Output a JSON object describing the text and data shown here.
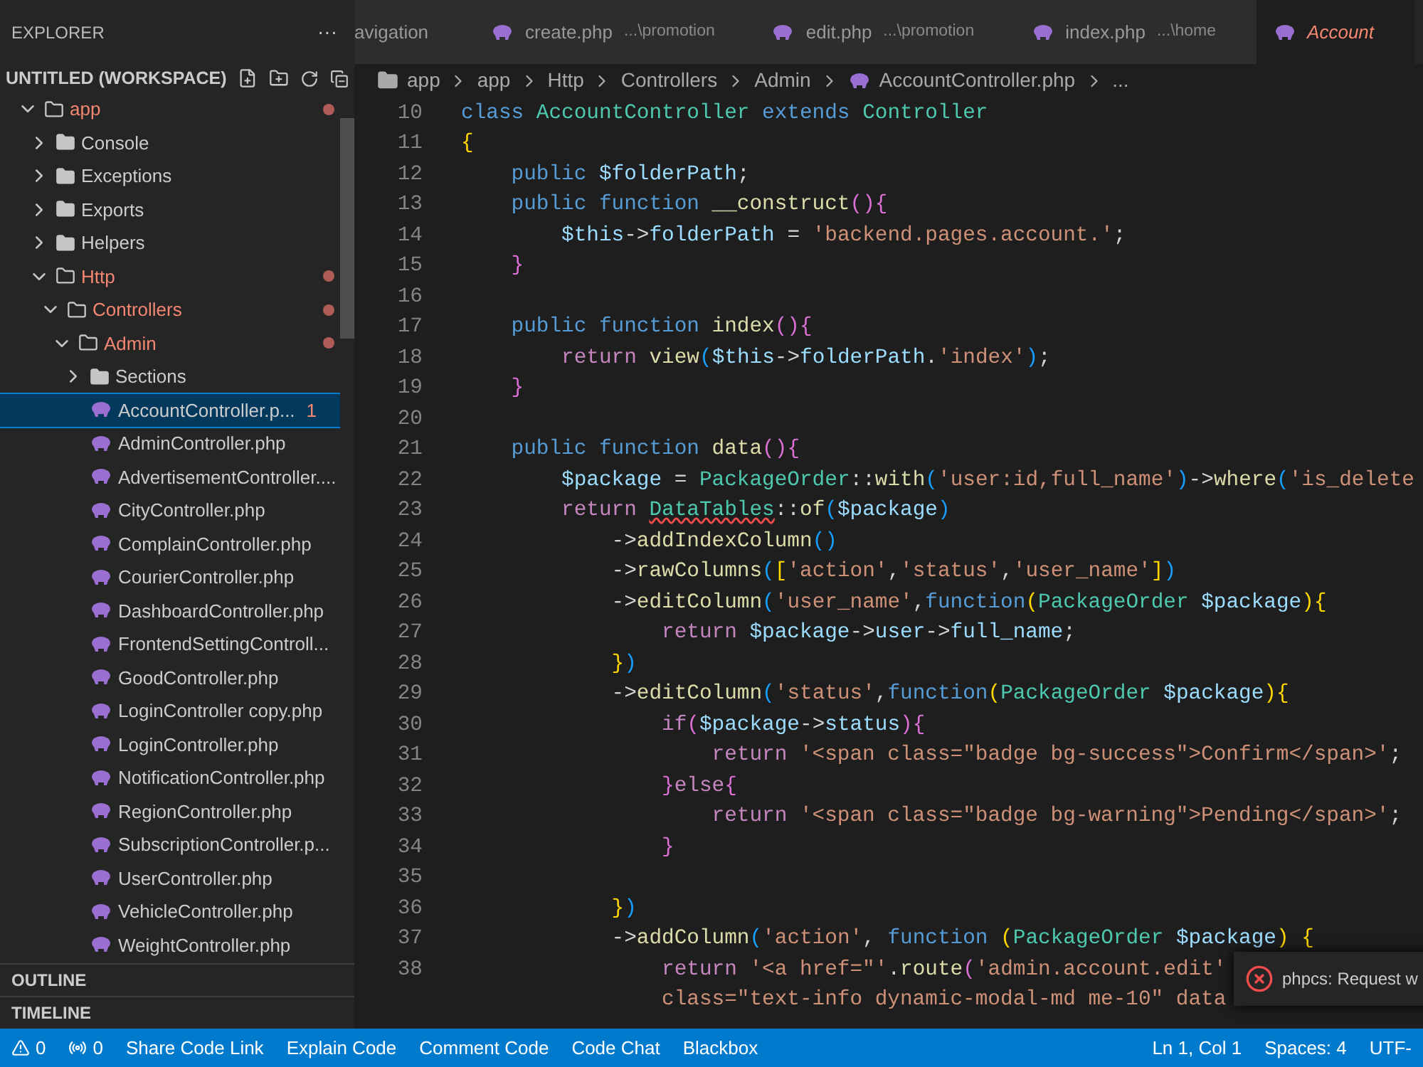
{
  "sidebar": {
    "title": "EXPLORER",
    "more": "···",
    "workspace": "UNTITLED (WORKSPACE)",
    "tree": [
      {
        "kind": "folder",
        "name": "app",
        "expanded": true,
        "modified": true,
        "selected": false,
        "children": [
          {
            "kind": "folder",
            "name": "Console",
            "expanded": false,
            "modified": false,
            "selected": false
          },
          {
            "kind": "folder",
            "name": "Exceptions",
            "expanded": false,
            "modified": false,
            "selected": false
          },
          {
            "kind": "folder",
            "name": "Exports",
            "expanded": false,
            "modified": false,
            "selected": false
          },
          {
            "kind": "folder",
            "name": "Helpers",
            "expanded": false,
            "modified": false,
            "selected": false
          },
          {
            "kind": "folder",
            "name": "Http",
            "expanded": true,
            "modified": true,
            "selected": false,
            "children": [
              {
                "kind": "folder",
                "name": "Controllers",
                "expanded": true,
                "modified": true,
                "selected": false,
                "children": [
                  {
                    "kind": "folder",
                    "name": "Admin",
                    "expanded": true,
                    "modified": true,
                    "selected": false,
                    "children": [
                      {
                        "kind": "folder",
                        "name": "Sections",
                        "expanded": false,
                        "modified": false,
                        "selected": false
                      },
                      {
                        "kind": "file",
                        "name": "AccountController.p...",
                        "badge": "1",
                        "selected": true
                      },
                      {
                        "kind": "file",
                        "name": "AdminController.php",
                        "selected": false
                      },
                      {
                        "kind": "file",
                        "name": "AdvertisementController....",
                        "selected": false
                      },
                      {
                        "kind": "file",
                        "name": "CityController.php",
                        "selected": false
                      },
                      {
                        "kind": "file",
                        "name": "ComplainController.php",
                        "selected": false
                      },
                      {
                        "kind": "file",
                        "name": "CourierController.php",
                        "selected": false
                      },
                      {
                        "kind": "file",
                        "name": "DashboardController.php",
                        "selected": false
                      },
                      {
                        "kind": "file",
                        "name": "FrontendSettingControll...",
                        "selected": false
                      },
                      {
                        "kind": "file",
                        "name": "GoodController.php",
                        "selected": false
                      },
                      {
                        "kind": "file",
                        "name": "LoginController copy.php",
                        "selected": false
                      },
                      {
                        "kind": "file",
                        "name": "LoginController.php",
                        "selected": false
                      },
                      {
                        "kind": "file",
                        "name": "NotificationController.php",
                        "selected": false
                      },
                      {
                        "kind": "file",
                        "name": "RegionController.php",
                        "selected": false
                      },
                      {
                        "kind": "file",
                        "name": "SubscriptionController.p...",
                        "selected": false
                      },
                      {
                        "kind": "file",
                        "name": "UserController.php",
                        "selected": false
                      },
                      {
                        "kind": "file",
                        "name": "VehicleController.php",
                        "selected": false
                      },
                      {
                        "kind": "file",
                        "name": "WeightController.php",
                        "selected": false
                      }
                    ]
                  }
                ]
              }
            ]
          }
        ]
      }
    ],
    "panels": [
      "OUTLINE",
      "TIMELINE"
    ]
  },
  "tabs": [
    {
      "kind": "plain",
      "name": "avigation",
      "selected": false,
      "has_error": false
    },
    {
      "kind": "php",
      "name": "create.php",
      "path": "...\\promotion",
      "selected": false,
      "has_error": false
    },
    {
      "kind": "php",
      "name": "edit.php",
      "path": "...\\promotion",
      "selected": false,
      "has_error": false
    },
    {
      "kind": "php",
      "name": "index.php",
      "path": "...\\home",
      "selected": false,
      "has_error": false
    },
    {
      "kind": "php",
      "name": "Account",
      "selected": true,
      "has_error": true
    }
  ],
  "breadcrumbs": [
    {
      "kind": "folder",
      "label": "app"
    },
    {
      "kind": "plain",
      "label": "app"
    },
    {
      "kind": "plain",
      "label": "Http"
    },
    {
      "kind": "plain",
      "label": "Controllers"
    },
    {
      "kind": "plain",
      "label": "Admin"
    },
    {
      "kind": "file",
      "label": "AccountController.php"
    },
    {
      "kind": "plain",
      "label": "..."
    }
  ],
  "code": [
    {
      "number": "10",
      "tokens": [
        {
          "text": "class ",
          "kind": "kw"
        },
        {
          "text": "AccountController ",
          "kind": "cls"
        },
        {
          "text": "extends ",
          "kind": "kw"
        },
        {
          "text": "Controller",
          "kind": "cls"
        }
      ]
    },
    {
      "number": "11",
      "tokens": [
        {
          "text": "{",
          "kind": "b1"
        }
      ]
    },
    {
      "number": "12",
      "tokens": [
        {
          "text": "    public ",
          "kind": "kw"
        },
        {
          "text": "$folderPath",
          "kind": "var"
        },
        {
          "text": ";",
          "kind": "p"
        }
      ]
    },
    {
      "number": "13",
      "tokens": [
        {
          "text": "    public function ",
          "kind": "kw"
        },
        {
          "text": "__construct",
          "kind": "fn"
        },
        {
          "text": "()",
          "kind": "b2"
        },
        {
          "text": "{",
          "kind": "b2"
        }
      ]
    },
    {
      "number": "14",
      "tokens": [
        {
          "text": "        $this",
          "kind": "var"
        },
        {
          "text": "->",
          "kind": "p"
        },
        {
          "text": "folderPath",
          "kind": "var"
        },
        {
          "text": " = ",
          "kind": "p"
        },
        {
          "text": "'backend.pages.account.'",
          "kind": "str"
        },
        {
          "text": ";",
          "kind": "p"
        }
      ]
    },
    {
      "number": "15",
      "tokens": [
        {
          "text": "    }",
          "kind": "b2"
        }
      ]
    },
    {
      "number": "16"
    },
    {
      "number": "17",
      "tokens": [
        {
          "text": "    public function ",
          "kind": "kw"
        },
        {
          "text": "index",
          "kind": "fn"
        },
        {
          "text": "()",
          "kind": "b2"
        },
        {
          "text": "{",
          "kind": "b2"
        }
      ]
    },
    {
      "number": "18",
      "tokens": [
        {
          "text": "        return ",
          "kind": "ctl"
        },
        {
          "text": "view",
          "kind": "fn"
        },
        {
          "text": "(",
          "kind": "b3"
        },
        {
          "text": "$this",
          "kind": "var"
        },
        {
          "text": "->",
          "kind": "p"
        },
        {
          "text": "folderPath",
          "kind": "var"
        },
        {
          "text": ".",
          "kind": "p"
        },
        {
          "text": "'index'",
          "kind": "str"
        },
        {
          "text": ")",
          "kind": "b3"
        },
        {
          "text": ";",
          "kind": "p"
        }
      ]
    },
    {
      "number": "19",
      "tokens": [
        {
          "text": "    }",
          "kind": "b2"
        }
      ]
    },
    {
      "number": "20"
    },
    {
      "number": "21",
      "tokens": [
        {
          "text": "    public function ",
          "kind": "kw"
        },
        {
          "text": "data",
          "kind": "fn"
        },
        {
          "text": "()",
          "kind": "b2"
        },
        {
          "text": "{",
          "kind": "b2"
        }
      ]
    },
    {
      "number": "22",
      "tokens": [
        {
          "text": "        $package",
          "kind": "var"
        },
        {
          "text": " = ",
          "kind": "p"
        },
        {
          "text": "PackageOrder",
          "kind": "cls"
        },
        {
          "text": "::",
          "kind": "p"
        },
        {
          "text": "with",
          "kind": "fn"
        },
        {
          "text": "(",
          "kind": "b3"
        },
        {
          "text": "'user:id,full_name'",
          "kind": "str"
        },
        {
          "text": ")",
          "kind": "b3"
        },
        {
          "text": "->",
          "kind": "p"
        },
        {
          "text": "where",
          "kind": "fn"
        },
        {
          "text": "(",
          "kind": "b3"
        },
        {
          "text": "'is_delete",
          "kind": "str"
        }
      ]
    },
    {
      "number": "23",
      "tokens": [
        {
          "text": "        return ",
          "kind": "ctl"
        },
        {
          "text": "DataTables",
          "kind": "err"
        },
        {
          "text": "::",
          "kind": "p"
        },
        {
          "text": "of",
          "kind": "fn"
        },
        {
          "text": "(",
          "kind": "b3"
        },
        {
          "text": "$package",
          "kind": "var"
        },
        {
          "text": ")",
          "kind": "b3"
        }
      ]
    },
    {
      "number": "24",
      "tokens": [
        {
          "text": "            ->",
          "kind": "p"
        },
        {
          "text": "addIndexColumn",
          "kind": "fn"
        },
        {
          "text": "()",
          "kind": "b3"
        }
      ]
    },
    {
      "number": "25",
      "tokens": [
        {
          "text": "            ->",
          "kind": "p"
        },
        {
          "text": "rawColumns",
          "kind": "fn"
        },
        {
          "text": "(",
          "kind": "b3"
        },
        {
          "text": "[",
          "kind": "b1"
        },
        {
          "text": "'action'",
          "kind": "str"
        },
        {
          "text": ",",
          "kind": "p"
        },
        {
          "text": "'status'",
          "kind": "str"
        },
        {
          "text": ",",
          "kind": "p"
        },
        {
          "text": "'user_name'",
          "kind": "str"
        },
        {
          "text": "]",
          "kind": "b1"
        },
        {
          "text": ")",
          "kind": "b3"
        }
      ]
    },
    {
      "number": "26",
      "tokens": [
        {
          "text": "            ->",
          "kind": "p"
        },
        {
          "text": "editColumn",
          "kind": "fn"
        },
        {
          "text": "(",
          "kind": "b3"
        },
        {
          "text": "'user_name'",
          "kind": "str"
        },
        {
          "text": ",",
          "kind": "p"
        },
        {
          "text": "function",
          "kind": "kw"
        },
        {
          "text": "(",
          "kind": "b1"
        },
        {
          "text": "PackageOrder ",
          "kind": "cls"
        },
        {
          "text": "$package",
          "kind": "var"
        },
        {
          "text": ")",
          "kind": "b1"
        },
        {
          "text": "{",
          "kind": "b1"
        }
      ]
    },
    {
      "number": "27",
      "tokens": [
        {
          "text": "                return ",
          "kind": "ctl"
        },
        {
          "text": "$package",
          "kind": "var"
        },
        {
          "text": "->",
          "kind": "p"
        },
        {
          "text": "user",
          "kind": "var"
        },
        {
          "text": "->",
          "kind": "p"
        },
        {
          "text": "full_name",
          "kind": "var"
        },
        {
          "text": ";",
          "kind": "p"
        }
      ]
    },
    {
      "number": "28",
      "tokens": [
        {
          "text": "            }",
          "kind": "b1"
        },
        {
          "text": ")",
          "kind": "b3"
        }
      ]
    },
    {
      "number": "29",
      "tokens": [
        {
          "text": "            ->",
          "kind": "p"
        },
        {
          "text": "editColumn",
          "kind": "fn"
        },
        {
          "text": "(",
          "kind": "b3"
        },
        {
          "text": "'status'",
          "kind": "str"
        },
        {
          "text": ",",
          "kind": "p"
        },
        {
          "text": "function",
          "kind": "kw"
        },
        {
          "text": "(",
          "kind": "b1"
        },
        {
          "text": "PackageOrder ",
          "kind": "cls"
        },
        {
          "text": "$package",
          "kind": "var"
        },
        {
          "text": ")",
          "kind": "b1"
        },
        {
          "text": "{",
          "kind": "b1"
        }
      ]
    },
    {
      "number": "30",
      "tokens": [
        {
          "text": "                if",
          "kind": "ctl"
        },
        {
          "text": "(",
          "kind": "b2"
        },
        {
          "text": "$package",
          "kind": "var"
        },
        {
          "text": "->",
          "kind": "p"
        },
        {
          "text": "status",
          "kind": "var"
        },
        {
          "text": ")",
          "kind": "b2"
        },
        {
          "text": "{",
          "kind": "b2"
        }
      ]
    },
    {
      "number": "31",
      "tokens": [
        {
          "text": "                    return ",
          "kind": "ctl"
        },
        {
          "text": "'<span class=\"badge bg-success\">Confirm</span>'",
          "kind": "str"
        },
        {
          "text": ";",
          "kind": "p"
        }
      ]
    },
    {
      "number": "32",
      "tokens": [
        {
          "text": "                }",
          "kind": "b2"
        },
        {
          "text": "else",
          "kind": "ctl"
        },
        {
          "text": "{",
          "kind": "b2"
        }
      ]
    },
    {
      "number": "33",
      "tokens": [
        {
          "text": "                    return ",
          "kind": "ctl"
        },
        {
          "text": "'<span class=\"badge bg-warning\">Pending</span>'",
          "kind": "str"
        },
        {
          "text": ";",
          "kind": "p"
        }
      ]
    },
    {
      "number": "34",
      "tokens": [
        {
          "text": "                }",
          "kind": "b2"
        }
      ]
    },
    {
      "number": "35"
    },
    {
      "number": "36",
      "tokens": [
        {
          "text": "            }",
          "kind": "b1"
        },
        {
          "text": ")",
          "kind": "b3"
        }
      ]
    },
    {
      "number": "37",
      "tokens": [
        {
          "text": "            ->",
          "kind": "p"
        },
        {
          "text": "addColumn",
          "kind": "fn"
        },
        {
          "text": "(",
          "kind": "b3"
        },
        {
          "text": "'action'",
          "kind": "str"
        },
        {
          "text": ", ",
          "kind": "p"
        },
        {
          "text": "function ",
          "kind": "kw"
        },
        {
          "text": "(",
          "kind": "b1"
        },
        {
          "text": "PackageOrder ",
          "kind": "cls"
        },
        {
          "text": "$package",
          "kind": "var"
        },
        {
          "text": ") ",
          "kind": "b1"
        },
        {
          "text": "{",
          "kind": "b1"
        }
      ]
    },
    {
      "number": "38",
      "tokens": [
        {
          "text": "                return ",
          "kind": "ctl"
        },
        {
          "text": "'<a href=\"'",
          "kind": "str"
        },
        {
          "text": ".",
          "kind": "p"
        },
        {
          "text": "route",
          "kind": "fn"
        },
        {
          "text": "(",
          "kind": "b2"
        },
        {
          "text": "'admin.account.edit'",
          "kind": "str"
        }
      ]
    },
    {
      "tokens": [
        {
          "text": "                class=\"text-info dynamic-modal-md me-10\" data",
          "kind": "str"
        }
      ]
    }
  ],
  "notification": {
    "kind": "error",
    "message": "phpcs: Request w"
  },
  "status_bar": {
    "left": [
      {
        "kind": "warnings",
        "label": "0"
      },
      {
        "kind": "ports",
        "label": "0"
      },
      {
        "kind": "text",
        "label": "Share Code Link"
      },
      {
        "kind": "text",
        "label": "Explain Code"
      },
      {
        "kind": "text",
        "label": "Comment Code"
      },
      {
        "kind": "text",
        "label": "Code Chat"
      },
      {
        "kind": "text",
        "label": "Blackbox"
      }
    ],
    "right": [
      "Ln 1, Col 1",
      "Spaces: 4",
      "UTF-"
    ]
  }
}
